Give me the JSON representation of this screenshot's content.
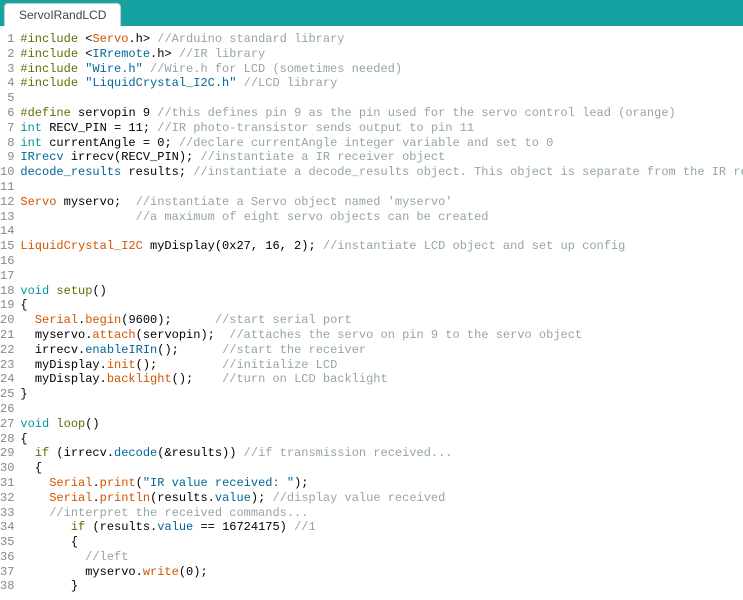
{
  "tab": {
    "title": "ServoIRandLCD"
  },
  "lines": [
    {
      "n": 1,
      "html": "<span class='kw-inc'>#include</span> <span class='plain'>&lt;</span><span class='kw-orange'>Servo</span><span class='plain'>.h&gt;</span> <span class='comment'>//Arduino standard library</span>"
    },
    {
      "n": 2,
      "html": "<span class='kw-inc'>#include</span> <span class='plain'>&lt;</span><span class='kw-lib'>IRremote</span><span class='plain'>.h&gt;</span> <span class='comment'>//IR library</span>"
    },
    {
      "n": 3,
      "html": "<span class='kw-inc'>#include</span> <span class='str'>\"Wire.h\"</span> <span class='comment'>//Wire.h for LCD (sometimes needed)</span>"
    },
    {
      "n": 4,
      "html": "<span class='kw-inc'>#include</span> <span class='str'>\"LiquidCrystal_I2C.h\"</span> <span class='comment'>//LCD library</span>"
    },
    {
      "n": 5,
      "html": ""
    },
    {
      "n": 6,
      "html": "<span class='kw-inc'>#define</span> <span class='plain'>servopin 9</span> <span class='comment'>//this defines pin 9 as the pin used for the servo control lead (orange)</span>"
    },
    {
      "n": 7,
      "html": "<span class='kw-type'>int</span> <span class='plain'>RECV_PIN = 11;</span> <span class='comment'>//IR photo-transistor sends output to pin 11</span>"
    },
    {
      "n": 8,
      "html": "<span class='kw-type'>int</span> <span class='plain'>currentAngle = 0;</span> <span class='comment'>//declare currentAngle integer variable and set to 0</span>"
    },
    {
      "n": 9,
      "html": "<span class='kw-lib'>IRrecv</span> <span class='plain'>irrecv(RECV_PIN);</span> <span class='comment'>//instantiate a IR receiver object</span>"
    },
    {
      "n": 10,
      "html": "<span class='kw-lib'>decode_results</span> <span class='plain'>results;</span> <span class='comment'>//instantiate a decode_results object. This object is separate from the IR receiver.</span>"
    },
    {
      "n": 11,
      "html": ""
    },
    {
      "n": 12,
      "html": "<span class='kw-orange'>Servo</span> <span class='plain'>myservo;</span>  <span class='comment'>//instantiate a Servo object named 'myservo'</span>"
    },
    {
      "n": 13,
      "html": "                <span class='comment'>//a maximum of eight servo objects can be created</span>"
    },
    {
      "n": 14,
      "html": ""
    },
    {
      "n": 15,
      "html": "<span class='kw-orange'>LiquidCrystal_I2C</span> <span class='plain'>myDisplay(0x27, 16, 2);</span> <span class='comment'>//instantiate LCD object and set up config</span>"
    },
    {
      "n": 16,
      "html": ""
    },
    {
      "n": 17,
      "html": ""
    },
    {
      "n": 18,
      "html": "<span class='kw-type'>void</span> <span class='kw-inc'>setup</span><span class='plain'>()</span>"
    },
    {
      "n": 19,
      "html": "<span class='plain'>{</span>"
    },
    {
      "n": 20,
      "html": "  <span class='kw-orange'>Serial</span><span class='plain'>.</span><span class='kw-orange'>begin</span><span class='plain'>(9600);</span>      <span class='comment'>//start serial port</span>"
    },
    {
      "n": 21,
      "html": "  <span class='plain'>myservo.</span><span class='kw-orange'>attach</span><span class='plain'>(servopin);</span>  <span class='comment'>//attaches the servo on pin 9 to the servo object</span>"
    },
    {
      "n": 22,
      "html": "  <span class='plain'>irrecv.</span><span class='kw-lib'>enableIRIn</span><span class='plain'>();</span>      <span class='comment'>//start the receiver</span>"
    },
    {
      "n": 23,
      "html": "  <span class='plain'>myDisplay.</span><span class='kw-orange'>init</span><span class='plain'>();</span>         <span class='comment'>//initialize LCD</span>"
    },
    {
      "n": 24,
      "html": "  <span class='plain'>myDisplay.</span><span class='kw-orange'>backlight</span><span class='plain'>();</span>    <span class='comment'>//turn on LCD backlight</span>"
    },
    {
      "n": 25,
      "html": "<span class='plain'>}</span>"
    },
    {
      "n": 26,
      "html": ""
    },
    {
      "n": 27,
      "html": "<span class='kw-type'>void</span> <span class='kw-inc'>loop</span><span class='plain'>()</span>"
    },
    {
      "n": 28,
      "html": "<span class='plain'>{</span>"
    },
    {
      "n": 29,
      "html": "  <span class='kw-inc'>if</span> <span class='plain'>(irrecv.</span><span class='kw-lib'>decode</span><span class='plain'>(&amp;results))</span> <span class='comment'>//if transmission received...</span>"
    },
    {
      "n": 30,
      "html": "  <span class='plain'>{</span>"
    },
    {
      "n": 31,
      "html": "    <span class='kw-orange'>Serial</span><span class='plain'>.</span><span class='kw-orange'>print</span><span class='plain'>(</span><span class='str'>\"IR value received: \"</span><span class='plain'>);</span>"
    },
    {
      "n": 32,
      "html": "    <span class='kw-orange'>Serial</span><span class='plain'>.</span><span class='kw-orange'>println</span><span class='plain'>(results.</span><span class='kw-lib'>value</span><span class='plain'>);</span> <span class='comment'>//display value received</span>"
    },
    {
      "n": 33,
      "html": "    <span class='comment'>//interpret the received commands...</span>"
    },
    {
      "n": 34,
      "html": "       <span class='kw-inc'>if</span> <span class='plain'>(results.</span><span class='kw-lib'>value</span> <span class='plain'>== 16724175)</span> <span class='comment'>//1</span>"
    },
    {
      "n": 35,
      "html": "       <span class='plain'>{</span>"
    },
    {
      "n": 36,
      "html": "         <span class='comment'>//left</span>"
    },
    {
      "n": 37,
      "html": "         <span class='plain'>myservo.</span><span class='kw-orange'>write</span><span class='plain'>(0);</span>"
    },
    {
      "n": 38,
      "html": "       <span class='plain'>}</span>"
    }
  ]
}
